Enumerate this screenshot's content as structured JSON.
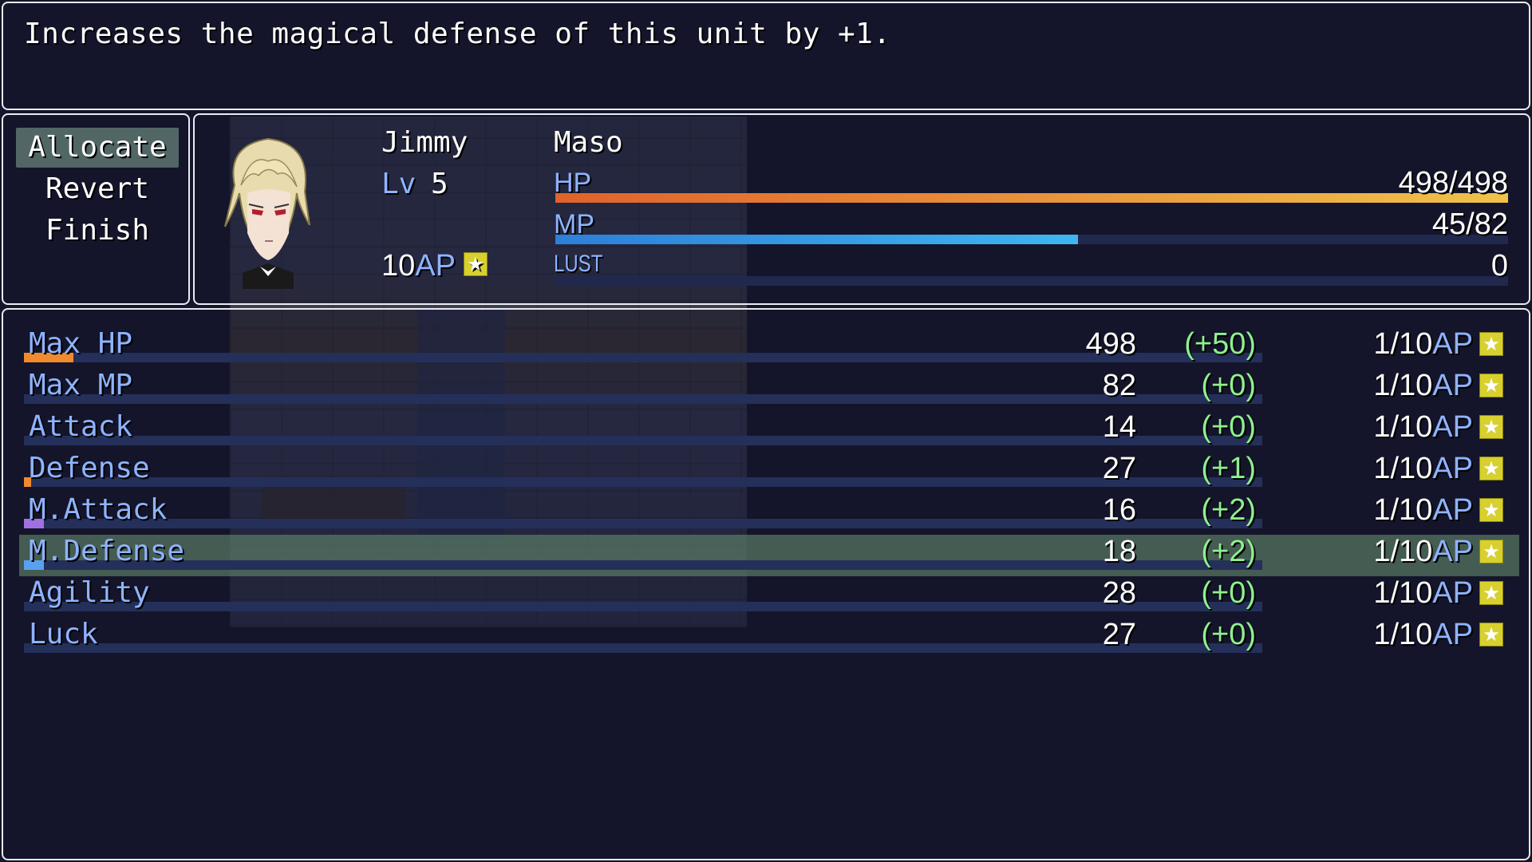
{
  "help": {
    "text": "Increases the magical defense of this unit by +1."
  },
  "commands": [
    {
      "label": "Allocate",
      "selected": true
    },
    {
      "label": "Revert",
      "selected": false
    },
    {
      "label": "Finish",
      "selected": false
    }
  ],
  "actor": {
    "name": "Jimmy",
    "class_name": "Maso",
    "level_label": "Lv",
    "level": "5",
    "ap_value": "10",
    "ap_unit": "AP",
    "hp": {
      "label": "HP",
      "text": "498/498",
      "ratio": 1.0
    },
    "mp": {
      "label": "MP",
      "text": "45/82",
      "ratio": 0.5488
    },
    "lust": {
      "label": "LUST",
      "text": "0",
      "ratio": 0
    }
  },
  "colors": {
    "hp_gradient": [
      "#e0622c",
      "#f0c24a"
    ],
    "mp_gradient": [
      "#2d7fd8",
      "#3fb6f0"
    ],
    "system_blue": "#8fb3ff",
    "bonus_green": "#8ef08e",
    "selected_highlight": "#648c6e",
    "star_yellow": "#d8d02e"
  },
  "params": [
    {
      "name": "Max HP",
      "value": "498",
      "bonus": "(+50)",
      "cost": "1/10",
      "ap": "AP",
      "fill": 0.04,
      "fill_color": "#f08a2e",
      "selected": false
    },
    {
      "name": "Max MP",
      "value": "82",
      "bonus": "(+0)",
      "cost": "1/10",
      "ap": "AP",
      "fill": 0.0,
      "fill_color": "#3fb6f0",
      "selected": false
    },
    {
      "name": "Attack",
      "value": "14",
      "bonus": "(+0)",
      "cost": "1/10",
      "ap": "AP",
      "fill": 0.0,
      "fill_color": "#e05050",
      "selected": false
    },
    {
      "name": "Defense",
      "value": "27",
      "bonus": "(+1)",
      "cost": "1/10",
      "ap": "AP",
      "fill": 0.006,
      "fill_color": "#f08a2e",
      "selected": false
    },
    {
      "name": "M.Attack",
      "value": "16",
      "bonus": "(+2)",
      "cost": "1/10",
      "ap": "AP",
      "fill": 0.016,
      "fill_color": "#a070e0",
      "selected": false
    },
    {
      "name": "M.Defense",
      "value": "18",
      "bonus": "(+2)",
      "cost": "1/10",
      "ap": "AP",
      "fill": 0.016,
      "fill_color": "#5aa0f0",
      "selected": true
    },
    {
      "name": "Agility",
      "value": "28",
      "bonus": "(+0)",
      "cost": "1/10",
      "ap": "AP",
      "fill": 0.0,
      "fill_color": "#60d080",
      "selected": false
    },
    {
      "name": "Luck",
      "value": "27",
      "bonus": "(+0)",
      "cost": "1/10",
      "ap": "AP",
      "fill": 0.0,
      "fill_color": "#e0d060",
      "selected": false
    }
  ],
  "icons": {
    "ap_star": "star-icon"
  }
}
